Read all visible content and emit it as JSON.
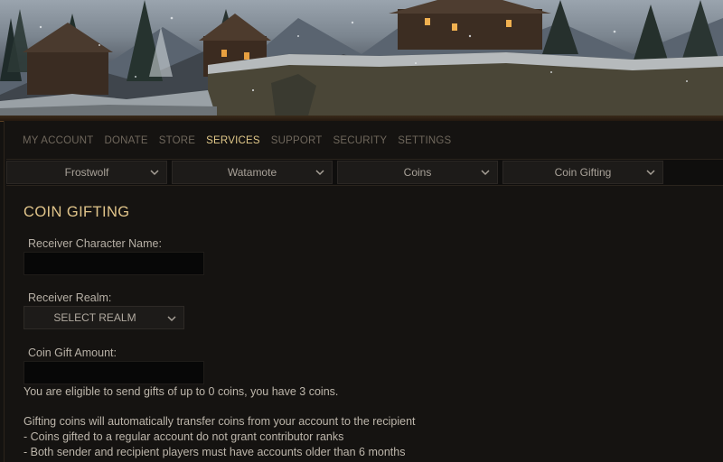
{
  "topnav": {
    "items": [
      "MY ACCOUNT",
      "DONATE",
      "STORE",
      "SERVICES",
      "SUPPORT",
      "SECURITY",
      "SETTINGS"
    ],
    "active": "SERVICES"
  },
  "subnav": {
    "selectors": [
      {
        "value": "Frostwolf"
      },
      {
        "value": "Watamote"
      },
      {
        "value": "Coins"
      },
      {
        "value": "Coin Gifting"
      }
    ]
  },
  "page": {
    "title": "COIN GIFTING"
  },
  "form": {
    "receiver_name": {
      "label": "Receiver Character Name:",
      "value": ""
    },
    "receiver_realm": {
      "label": "Receiver Realm:",
      "selected": "SELECT REALM"
    },
    "amount": {
      "label": "Coin Gift Amount:",
      "value": ""
    },
    "eligibility": "You are eligible to send gifts of up to 0 coins, you have 3 coins."
  },
  "notes": {
    "intro": "Gifting coins will automatically transfer coins from your account to the recipient",
    "lines": [
      "- Coins gifted to a regular account do not grant contributor ranks",
      "- Both sender and recipient players must have accounts older than 6 months"
    ]
  },
  "colors": {
    "accent": "#e0c48a",
    "nav_inactive": "#6f675c",
    "background": "#151311"
  },
  "icons": {
    "dropdown": "chevron-down-icon"
  }
}
